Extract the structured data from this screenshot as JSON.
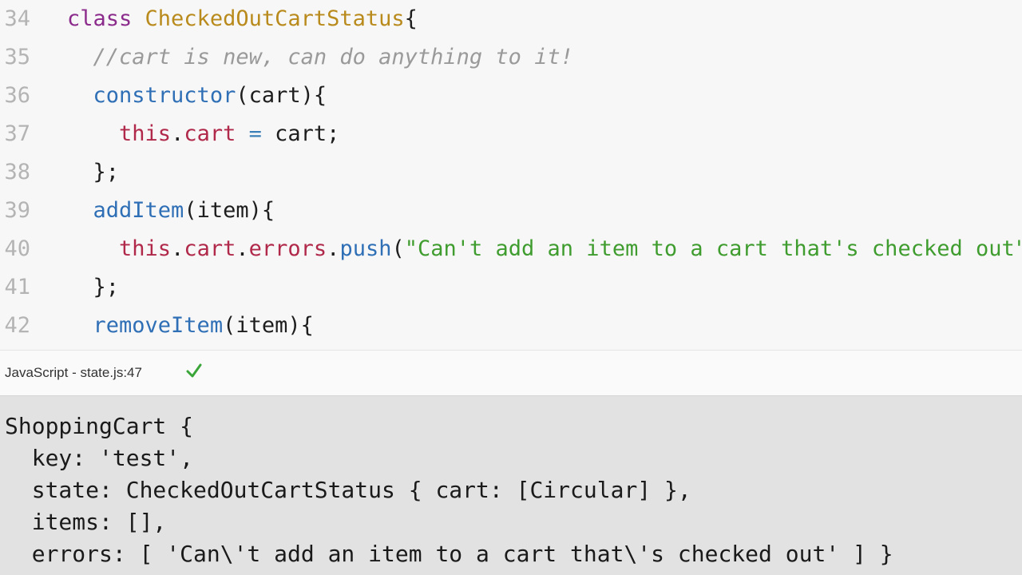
{
  "editor": {
    "lines": [
      {
        "num": "34",
        "segments": [
          {
            "t": "class ",
            "c": "kw"
          },
          {
            "t": "CheckedOutCartStatus",
            "c": "cls"
          },
          {
            "t": "{",
            "c": ""
          }
        ]
      },
      {
        "num": "35",
        "segments": [
          {
            "t": "  //cart is new, can do anything to it!",
            "c": "cmt"
          }
        ]
      },
      {
        "num": "36",
        "segments": [
          {
            "t": "  ",
            "c": ""
          },
          {
            "t": "constructor",
            "c": "fn"
          },
          {
            "t": "(cart){",
            "c": ""
          }
        ]
      },
      {
        "num": "37",
        "segments": [
          {
            "t": "    ",
            "c": ""
          },
          {
            "t": "this",
            "c": "this"
          },
          {
            "t": ".",
            "c": ""
          },
          {
            "t": "cart",
            "c": "this"
          },
          {
            "t": " ",
            "c": ""
          },
          {
            "t": "=",
            "c": "op"
          },
          {
            "t": " cart;",
            "c": ""
          }
        ]
      },
      {
        "num": "38",
        "segments": [
          {
            "t": "  };",
            "c": ""
          }
        ]
      },
      {
        "num": "39",
        "segments": [
          {
            "t": "  ",
            "c": ""
          },
          {
            "t": "addItem",
            "c": "fn"
          },
          {
            "t": "(item){",
            "c": ""
          }
        ]
      },
      {
        "num": "40",
        "segments": [
          {
            "t": "    ",
            "c": ""
          },
          {
            "t": "this",
            "c": "this"
          },
          {
            "t": ".",
            "c": ""
          },
          {
            "t": "cart",
            "c": "this"
          },
          {
            "t": ".",
            "c": ""
          },
          {
            "t": "errors",
            "c": "this"
          },
          {
            "t": ".",
            "c": ""
          },
          {
            "t": "push",
            "c": "fn"
          },
          {
            "t": "(",
            "c": ""
          },
          {
            "t": "\"Can't add an item to a cart that's checked out\"",
            "c": "str"
          }
        ]
      },
      {
        "num": "41",
        "segments": [
          {
            "t": "  };",
            "c": ""
          }
        ]
      },
      {
        "num": "42",
        "segments": [
          {
            "t": "  ",
            "c": ""
          },
          {
            "t": "removeItem",
            "c": "fn"
          },
          {
            "t": "(item){",
            "c": ""
          }
        ]
      }
    ]
  },
  "status": {
    "label": "JavaScript - state.js:47",
    "icon": "checkmark-icon",
    "icon_color": "#3aa63a"
  },
  "console": {
    "lines": [
      "ShoppingCart {",
      "  key: 'test',",
      "  state: CheckedOutCartStatus { cart: [Circular] },",
      "  items: [],",
      "  errors: [ 'Can\\'t add an item to a cart that\\'s checked out' ] }"
    ]
  }
}
